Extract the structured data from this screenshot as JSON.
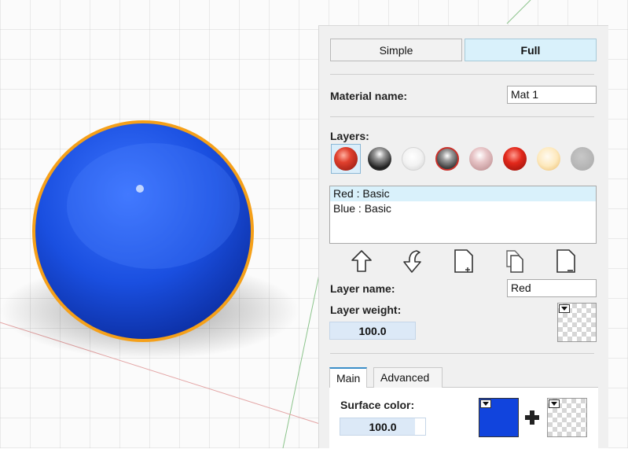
{
  "mode_toggle": {
    "simple_label": "Simple",
    "full_label": "Full",
    "active": "Full"
  },
  "material": {
    "name_label": "Material name:",
    "name_value": "Mat 1"
  },
  "layers": {
    "heading": "Layers:",
    "presets": [
      {
        "name": "red-glossy-icon",
        "color": "#d43a2a"
      },
      {
        "name": "chrome-icon",
        "color": "#333333"
      },
      {
        "name": "white-matte-icon",
        "color": "#eeeeee"
      },
      {
        "name": "metal-red-rim-icon",
        "color": "#888888"
      },
      {
        "name": "pink-gloss-icon",
        "color": "#d9b0b4"
      },
      {
        "name": "red-sparkle-icon",
        "color": "#d8281c"
      },
      {
        "name": "cream-glow-icon",
        "color": "#fbe5b0"
      },
      {
        "name": "gray-matte-icon",
        "color": "#b8b8b8"
      }
    ],
    "list": [
      "Red : Basic",
      "Blue : Basic"
    ],
    "selected_index": 0
  },
  "toolbar": {
    "move_up": "move-up-icon",
    "move_down": "move-down-icon",
    "add": "add-layer-icon",
    "duplicate": "duplicate-layer-icon",
    "remove": "remove-layer-icon"
  },
  "layer": {
    "name_label": "Layer name:",
    "name_value": "Red",
    "weight_label": "Layer weight:",
    "weight_value": "100.0"
  },
  "tabs": {
    "main_label": "Main",
    "advanced_label": "Advanced",
    "active": "Main"
  },
  "surface": {
    "label": "Surface color:",
    "value": "100.0",
    "value_fraction": 0.88,
    "color": "#1144dd"
  },
  "sphere": {
    "color": "#1a4fe0",
    "outline_color": "#f5a019"
  }
}
